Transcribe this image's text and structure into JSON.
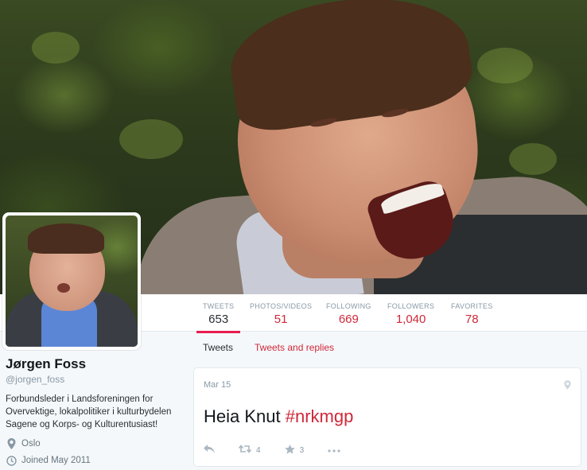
{
  "header": {
    "banner_icon": "profile-banner-photo",
    "avatar_icon": "profile-avatar-photo"
  },
  "nav": {
    "stats": [
      {
        "label": "TWEETS",
        "value": "653"
      },
      {
        "label": "PHOTOS/VIDEOS",
        "value": "51"
      },
      {
        "label": "FOLLOWING",
        "value": "669"
      },
      {
        "label": "FOLLOWERS",
        "value": "1,040"
      },
      {
        "label": "FAVORITES",
        "value": "78"
      }
    ]
  },
  "profile": {
    "name": "Jørgen Foss",
    "handle": "@jorgen_foss",
    "bio": "Forbundsleder i Landsforeningen for Overvektige, lokalpolitiker i kulturbydelen Sagene og Korps- og Kulturentusiast!",
    "location": "Oslo",
    "joined": "Joined May 2011"
  },
  "tabs": {
    "tweets": "Tweets",
    "tweets_replies": "Tweets and replies"
  },
  "tweet": {
    "date": "Mar 15",
    "text": "Heia Knut ",
    "hashtag": "#nrkmgp",
    "retweets": "4",
    "favorites": "3"
  },
  "colors": {
    "accent": "#d0283a",
    "muted": "#8899a6",
    "background": "#f5f8fa"
  }
}
